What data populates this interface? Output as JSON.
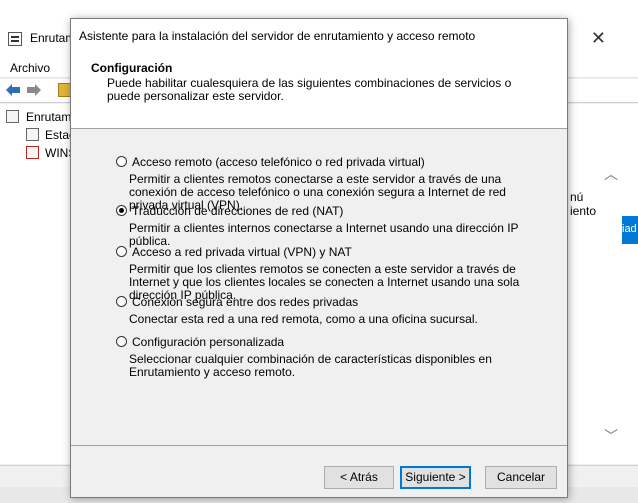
{
  "background_window": {
    "title": "Enrutam",
    "menu": [
      "Archivo"
    ],
    "tree": [
      "Enrutam",
      "Estad",
      "WINS"
    ],
    "right_text": "nú\niento",
    "blue_tab": "iad"
  },
  "dialog": {
    "title": "Asistente para la instalación del servidor de enrutamiento y acceso remoto",
    "header": {
      "title": "Configuración",
      "subtitle": "Puede habilitar cualesquiera de las siguientes combinaciones de servicios o puede personalizar este servidor."
    },
    "options": [
      {
        "label": "Acceso remoto (acceso telefónico o red privada virtual)",
        "description": "Permitir a clientes remotos conectarse a este servidor a través de una conexión de acceso telefónico o una conexión segura a Internet de red privada virtual (VPN).",
        "checked": false
      },
      {
        "label": "Traducción de direcciones de red (NAT)",
        "description": "Permitir a clientes internos conectarse a Internet usando una dirección IP pública.",
        "checked": true
      },
      {
        "label": "Acceso a red privada virtual (VPN) y NAT",
        "description": "Permitir que los clientes remotos se conecten a este servidor a través de Internet y que los clientes locales se conecten a Internet usando una sola dirección IP pública.",
        "checked": false
      },
      {
        "label": "Conexión segura entre dos redes privadas",
        "description": "Conectar esta red a una red remota, como a una oficina sucursal.",
        "checked": false
      },
      {
        "label": "Configuración personalizada",
        "description": "Seleccionar cualquier combinación de características disponibles en Enrutamiento y acceso remoto.",
        "checked": false
      }
    ],
    "buttons": {
      "back": "< Atrás",
      "next": "Siguiente >",
      "cancel": "Cancelar"
    }
  }
}
